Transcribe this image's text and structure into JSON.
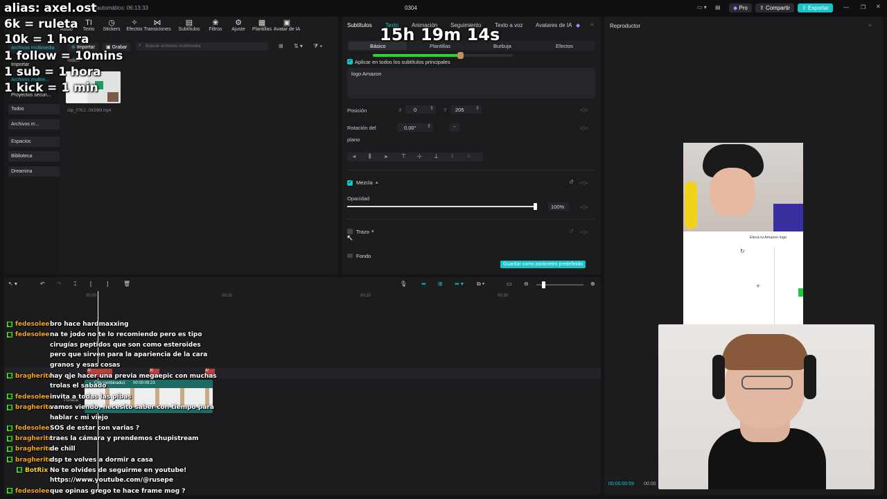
{
  "titlebar": {
    "autosave": "do automático: 06:13:33",
    "project": "0304",
    "pro_label": "Pro",
    "share_label": "Compartir",
    "export_label": "Exportar"
  },
  "media": {
    "tools": [
      {
        "label": "Audio",
        "icon": "music-note-icon",
        "glyph": "♪"
      },
      {
        "label": "Texto",
        "icon": "text-icon",
        "glyph": "TI"
      },
      {
        "label": "Stickers",
        "icon": "sticker-icon",
        "glyph": "◷"
      },
      {
        "label": "Efectos",
        "icon": "effects-icon",
        "glyph": "✧"
      },
      {
        "label": "Transiciones",
        "icon": "transition-icon",
        "glyph": "⋈"
      },
      {
        "label": "Subtítulos",
        "icon": "captions-icon",
        "glyph": "▤"
      },
      {
        "label": "Filtros",
        "icon": "filter-icon",
        "glyph": "❀"
      },
      {
        "label": "Ajuste",
        "icon": "adjust-icon",
        "glyph": "⚙"
      },
      {
        "label": "Plantillas",
        "icon": "template-icon",
        "glyph": "▦"
      },
      {
        "label": "Avatar de IA",
        "icon": "avatar-icon",
        "glyph": "▣"
      }
    ],
    "sidebar": [
      "Archivos multimedia",
      "Importar",
      "Archivos multim...",
      "Proyectos secun...",
      "Todos",
      "Archivos m...",
      "Espacios",
      "Biblioteca",
      "Dreamina"
    ],
    "import_label": "Importar",
    "record_label": "Grabar",
    "search_placeholder": "Buscar archivos multimedia",
    "all_label": "Todos",
    "clip_name": "clip_07KJ...0K59M.mp4"
  },
  "props": {
    "tabs": [
      "Subtítulos",
      "Texto",
      "Animación",
      "Seguimiento",
      "Texto a voz",
      "Avatares de IA"
    ],
    "subtabs": [
      "Básico",
      "Plantillas",
      "Burbuja",
      "Efectos"
    ],
    "apply_all": "Aplicar en todos los subtítulos principales",
    "text_value": "logo Amazon",
    "position_label": "Posición",
    "x_label": "X",
    "x_value": "0",
    "y_label": "Y",
    "y_value": "205",
    "rotation_label_1": "Rotación del",
    "rotation_label_2": "plano",
    "rotation_value": "0.00°",
    "rotation_dash": "-",
    "blend_label": "Mezcla",
    "opacity_label": "Opacidad",
    "opacity_value": "100%",
    "opacity_fraction": 1.0,
    "stroke_label": "Trazo",
    "bg_label": "Fondo",
    "save_default": "Guardar como parámetro predefinido"
  },
  "player": {
    "title": "Reproductor",
    "overlay_text_a": "Elevá tu",
    "overlay_text_b": "Amazon logo",
    "time_current": "00:00:00:59",
    "time_total": "00:00"
  },
  "timeline": {
    "ticks": [
      "00:00",
      "00:10",
      "00:20",
      "00:30"
    ],
    "clip_label": "Clip combinado1",
    "clip_duration": "00:00:09:23",
    "cover_label": "Portada"
  },
  "stream": {
    "overlay_lines": [
      "alias: axel.ost",
      "6k = ruleta",
      "10k = 1 hora",
      "1 follow = 10mins",
      "1 sub = 1 hora",
      "1 kick = 1 min"
    ],
    "timer": "15h 19m 14s",
    "chat": [
      {
        "user": "fedesolee",
        "color": "#f5a623",
        "lines": [
          "bro hace hardmaxxing"
        ]
      },
      {
        "user": "fedesolee",
        "color": "#f5a623",
        "lines": [
          "na te jodo no te lo recomiendo pero es tipo",
          "cirugías peptidos que son como esteroides",
          "pero que sirven para la apariencia de la cara",
          "granos y esas cosas"
        ]
      },
      {
        "user": "bragherito",
        "color": "#f5a623",
        "lines": [
          "hay qje hacer una previa megaepic con muchas",
          "trolas el sabado"
        ]
      },
      {
        "user": "fedesolee",
        "color": "#f5a623",
        "lines": [
          "invita a todas las pibas"
        ]
      },
      {
        "user": "bragherito",
        "color": "#f5a623",
        "lines": [
          "vamos viendo, necesito saber con tiempo para",
          "hablar c mi viejo"
        ]
      },
      {
        "user": "fedesolee",
        "color": "#f5a623",
        "lines": [
          "SOS de estar con varias ?"
        ]
      },
      {
        "user": "bragherito",
        "color": "#f5a623",
        "lines": [
          "traes la cámara y prendemos chupistream"
        ]
      },
      {
        "user": "bragherito",
        "color": "#f5a623",
        "lines": [
          "de chill"
        ]
      },
      {
        "user": "bragherito",
        "color": "#f5a623",
        "lines": [
          "dsp te volves a dormir a casa"
        ]
      },
      {
        "user": "BotRix",
        "color": "#f5d623",
        "lines": [
          "No te olvides de seguirme en youtube!",
          "https://www.youtube.com/@rusepe"
        ]
      },
      {
        "user": "fedesolee",
        "color": "#f5a623",
        "lines": [
          "que opinas grego te hace frame mog ?"
        ]
      }
    ]
  },
  "colors": {
    "accent": "#19c3c7",
    "kick": "#53fc18",
    "username": "#f5a623"
  }
}
